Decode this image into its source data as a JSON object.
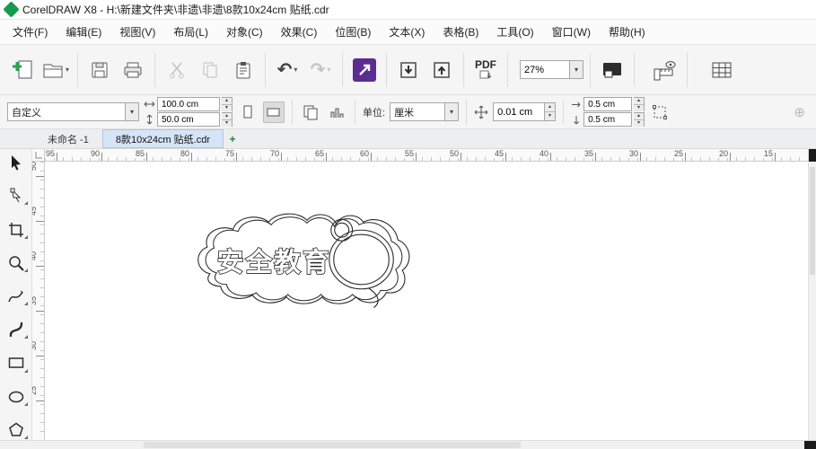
{
  "titlebar": {
    "title": "CorelDRAW X8 - H:\\新建文件夹\\非遗\\非遗\\8款10x24cm 贴纸.cdr"
  },
  "menu": {
    "file": "文件(F)",
    "edit": "编辑(E)",
    "view": "视图(V)",
    "layout": "布局(L)",
    "object": "对象(C)",
    "effects": "效果(C)",
    "bitmaps": "位图(B)",
    "text": "文本(X)",
    "table": "表格(B)",
    "tools": "工具(O)",
    "window": "窗口(W)",
    "help": "帮助(H)"
  },
  "toolbar": {
    "zoom_value": "27%",
    "pdf_label": "PDF"
  },
  "propbar": {
    "preset": "自定义",
    "page_width": "100.0 cm",
    "page_height": "50.0 cm",
    "units_label": "单位:",
    "units_value": "厘米",
    "nudge_value": "0.01 cm",
    "dup_x": "0.5 cm",
    "dup_y": "0.5 cm"
  },
  "tabs": {
    "tab1": "未命名 -1",
    "tab2": "8款10x24cm 贴纸.cdr",
    "new_tab": "+"
  },
  "rulers": {
    "h_labels": [
      "95",
      "90",
      "85",
      "80",
      "75",
      "70",
      "65",
      "60",
      "55",
      "50",
      "45",
      "40",
      "35",
      "30",
      "25",
      "20",
      "15"
    ],
    "v_labels": [
      "50",
      "45",
      "40",
      "35",
      "30",
      "25"
    ]
  },
  "canvas": {
    "sticker_text": "安全教育"
  },
  "icons": {
    "undo": "↶",
    "redo": "↷",
    "dropdown": "▾",
    "stepper_up": "▴",
    "stepper_down": "▾",
    "plus_circle": "⊕"
  },
  "colors": {
    "accent_purple": "#5b2d90",
    "logo_green": "#169b4e",
    "icon_dark": "#4a4a4a",
    "icon_disabled": "#c0c0c0",
    "active_tab": "#d5e5f7"
  }
}
